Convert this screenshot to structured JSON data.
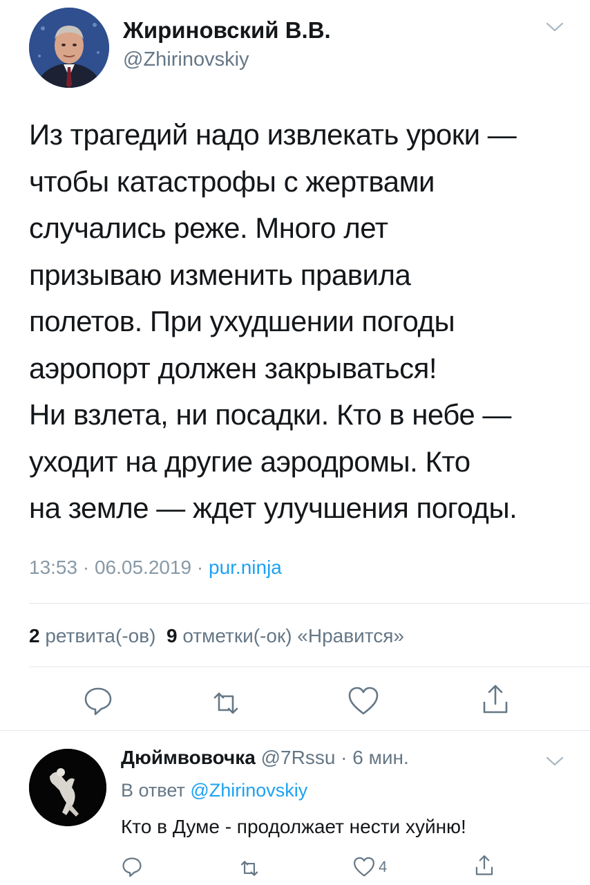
{
  "tweet": {
    "display_name": "Жириновский В.В.",
    "handle": "@Zhirinovskiy",
    "text_lines": [
      "Из трагедий надо извлекать уроки —",
      "чтобы катастрофы с жертвами",
      "случались реже. Много лет",
      "призываю изменить правила",
      "полетов. При ухудшении погоды",
      "аэропорт должен закрываться!",
      "Ни взлета, ни посадки. Кто в небе —",
      "уходит на другие аэродромы. Кто",
      "на земле — ждет улучшения погоды."
    ],
    "time": "13:53",
    "separator": " · ",
    "date": "06.05.2019",
    "source": "pur.ninja",
    "retweet_count": "2",
    "retweet_label": " ретвита(-ов)",
    "like_count": "9",
    "like_label": " отметки(-ок) «Нравится»"
  },
  "actions": {
    "reply_icon": "reply-icon",
    "retweet_icon": "retweet-icon",
    "like_icon": "heart-icon",
    "share_icon": "share-icon"
  },
  "reply": {
    "display_name": "Дюймвовочка",
    "handle": " @7Rssu",
    "separator": " · ",
    "age": "6 мин.",
    "in_reply_prefix": "В ответ ",
    "in_reply_mention": "@Zhirinovskiy",
    "text": "Кто в Думе - продолжает нести хуйню!",
    "like_count": "4"
  },
  "colors": {
    "text": "#14171a",
    "secondary": "#657786",
    "accent": "#1da1f2",
    "divider": "#e1e8ed"
  }
}
